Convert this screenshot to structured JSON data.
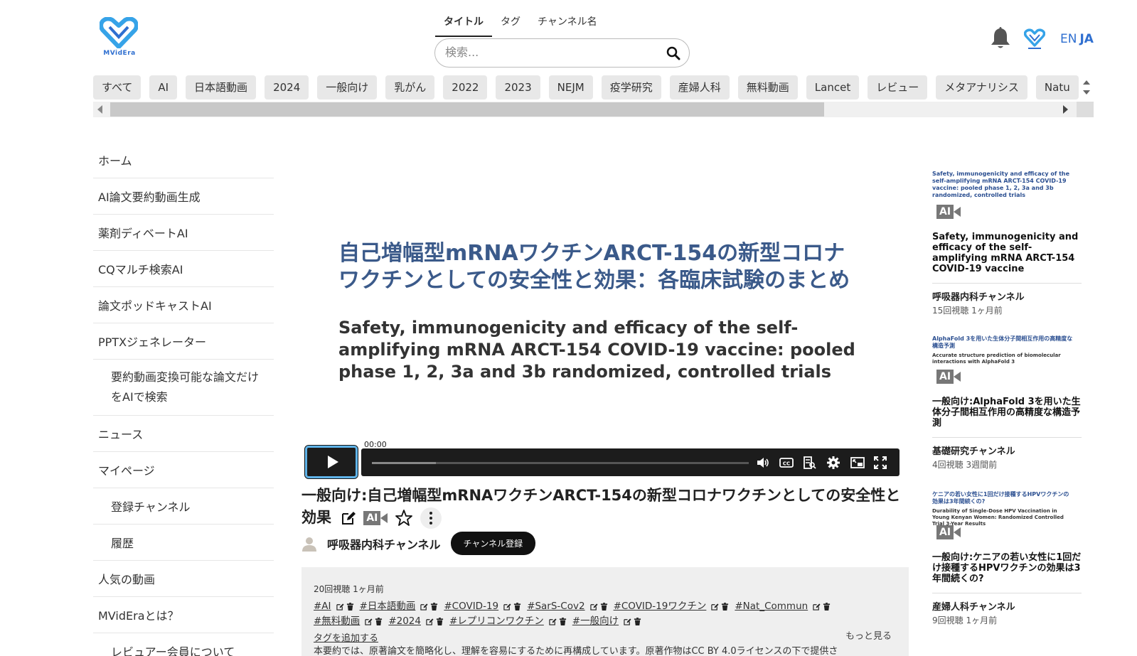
{
  "brand": {
    "name": "MVidEra",
    "color": "#2f6fd0"
  },
  "search": {
    "tabs": [
      {
        "label": "タイトル",
        "active": true
      },
      {
        "label": "タグ",
        "active": false
      },
      {
        "label": "チャンネル名",
        "active": false
      }
    ],
    "placeholder": "検索..."
  },
  "header": {
    "lang_en": "EN",
    "lang_ja": "JA"
  },
  "chips": [
    "すべて",
    "AI",
    "日本語動画",
    "2024",
    "一般向け",
    "乳がん",
    "2022",
    "2023",
    "NEJM",
    "疫学研究",
    "産婦人科",
    "無料動画",
    "Lancet",
    "レビュー",
    "メタアナリシス",
    "Natu"
  ],
  "sidebar": {
    "items": [
      {
        "label": "ホーム",
        "sub": false
      },
      {
        "label": "AI論文要約動画生成",
        "sub": false
      },
      {
        "label": "薬剤ディベートAI",
        "sub": false
      },
      {
        "label": "CQマルチ検索AI",
        "sub": false
      },
      {
        "label": "論文ポッドキャストAI",
        "sub": false
      },
      {
        "label": "PPTXジェネレーター",
        "sub": false
      },
      {
        "label": "要約動画変換可能な論文だけをAIで検索",
        "sub": true
      },
      {
        "label": "ニュース",
        "sub": false
      },
      {
        "label": "マイページ",
        "sub": false
      },
      {
        "label": "登録チャンネル",
        "sub": true
      },
      {
        "label": "履歴",
        "sub": true
      },
      {
        "label": "人気の動画",
        "sub": false
      },
      {
        "label": "MVidEraとは？",
        "sub": false
      },
      {
        "label": "レビュアー会員について",
        "sub": true
      }
    ]
  },
  "video": {
    "slide_title_ja": "自己増幅型mRNAワクチンARCT-154の新型コロナワクチンとしての安全性と効果：各臨床試験のまとめ",
    "slide_title_en": "Safety, immunogenicity and efficacy of the self-amplifying mRNA ARCT-154 COVID-19 vaccine: pooled phase 1, 2, 3a and 3b randomized, controlled trials",
    "current_time": "00:00",
    "progress": 0
  },
  "info": {
    "title": "一般向け:自己増幅型mRNAワクチンARCT-154の新型コロナワクチンとしての安全性と効果",
    "ai_label": "AI",
    "channel": "呼吸器内科チャンネル",
    "subscribe_label": "チャンネル登録",
    "views": "20回視聴 1ヶ月前",
    "tags": [
      "#AI",
      "#日本語動画",
      "#COVID-19",
      "#SarS-Cov2",
      "#COVID-19ワクチン",
      "#Nat_Commun",
      "#無料動画",
      "#2024",
      "#レプリコンワクチン",
      "#一般向け"
    ],
    "add_tag": "タグを追加する",
    "more": "もっと見る",
    "summary": "本要約では、原著論文を簡略化し、理解を容易にするために再構成しています。原著作物はCC BY 4.0ライセンスの下で提供さ"
  },
  "related": [
    {
      "thumb_title": "Safety, immunogenicity and efficacy of the self-amplifying mRNA ARCT-154 COVID-19 vaccine: pooled phase 1, 2, 3a and 3b randomized, controlled trials",
      "thumb_sub": "",
      "ai_label": "AI",
      "title": "Safety, immunogenicity and efficacy of the self-amplifying mRNA ARCT-154 COVID-19 vaccine",
      "channel": "呼吸器内科チャンネル",
      "meta": "15回視聴 1ヶ月前"
    },
    {
      "thumb_title": "AlphaFold 3を用いた生体分子間相互作用の高精度な構造予測",
      "thumb_sub": "Accurate structure prediction of biomolecular interactions with AlphaFold 3",
      "ai_label": "AI",
      "title": "一般向け:AlphaFold 3を用いた生体分子間相互作用の高精度な構造予測",
      "channel": "基礎研究チャンネル",
      "meta": "4回視聴 3週間前"
    },
    {
      "thumb_title": "ケニアの若い女性に1回だけ接種するHPVワクチンの効果は3年間続くの?",
      "thumb_sub": "Durability of Single-Dose HPV Vaccination in Young Kenyan Women: Randomized Controlled Trial 3-Year Results",
      "ai_label": "AI",
      "title": "一般向け:ケニアの若い女性に1回だけ接種するHPVワクチンの効果は3年間続くの?",
      "channel": "産婦人科チャンネル",
      "meta": "9回視聴 1ヶ月前"
    }
  ]
}
